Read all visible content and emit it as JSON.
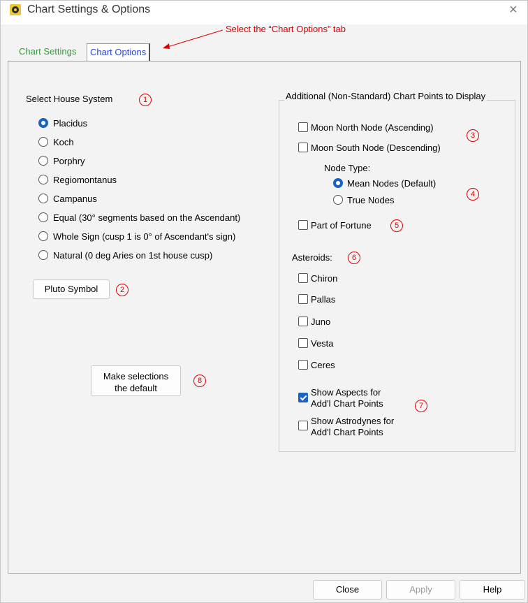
{
  "window": {
    "title": "Chart Settings & Options",
    "close_glyph": "×",
    "icon": "app-icon"
  },
  "annotations": {
    "select_tab_note": "Select the “Chart Options” tab",
    "markers": [
      "1",
      "2",
      "3",
      "4",
      "5",
      "6",
      "7",
      "8"
    ],
    "color": "#e00000"
  },
  "tabs": [
    {
      "label": "Chart Settings",
      "selected": false,
      "color": "#2aa036"
    },
    {
      "label": "Chart Options",
      "selected": true,
      "color": "#2b45d6"
    }
  ],
  "house_system": {
    "heading": "Select House System",
    "options": [
      {
        "label": "Placidus",
        "selected": true
      },
      {
        "label": "Koch",
        "selected": false
      },
      {
        "label": "Porphry",
        "selected": false
      },
      {
        "label": "Regiomontanus",
        "selected": false
      },
      {
        "label": "Campanus",
        "selected": false
      },
      {
        "label": "Equal (30° segments based on the Ascendant)",
        "selected": false
      },
      {
        "label": "Whole Sign (cusp 1 is 0° of Ascendant's sign)",
        "selected": false
      },
      {
        "label": "Natural (0 deg Aries on 1st house cusp)",
        "selected": false
      }
    ]
  },
  "pluto_button": "Pluto Symbol",
  "default_button": {
    "line1": "Make selections",
    "line2": "the default"
  },
  "chart_points": {
    "heading": "Additional (Non-Standard) Chart Points to Display",
    "moon_north": {
      "label": "Moon North Node (Ascending)",
      "checked": false
    },
    "moon_south": {
      "label": "Moon South Node (Descending)",
      "checked": false
    },
    "node_type_label": "Node Type:",
    "node_types": [
      {
        "label": "Mean Nodes (Default)",
        "selected": true
      },
      {
        "label": "True Nodes",
        "selected": false
      }
    ],
    "part_of_fortune": {
      "label": "Part of Fortune",
      "checked": false
    },
    "asteroids_label": "Asteroids:",
    "asteroids": [
      {
        "label": "Chiron",
        "checked": false
      },
      {
        "label": "Pallas",
        "checked": false
      },
      {
        "label": "Juno",
        "checked": false
      },
      {
        "label": "Vesta",
        "checked": false
      },
      {
        "label": "Ceres",
        "checked": false
      }
    ],
    "show_aspects": {
      "line1": "Show Aspects for",
      "line2": "Add'l Chart Points",
      "checked": true
    },
    "show_astrodynes": {
      "line1": "Show Astrodynes for",
      "line2": "Add'l Chart Points",
      "checked": false
    }
  },
  "footer": {
    "close": "Close",
    "apply": "Apply",
    "help": "Help"
  }
}
